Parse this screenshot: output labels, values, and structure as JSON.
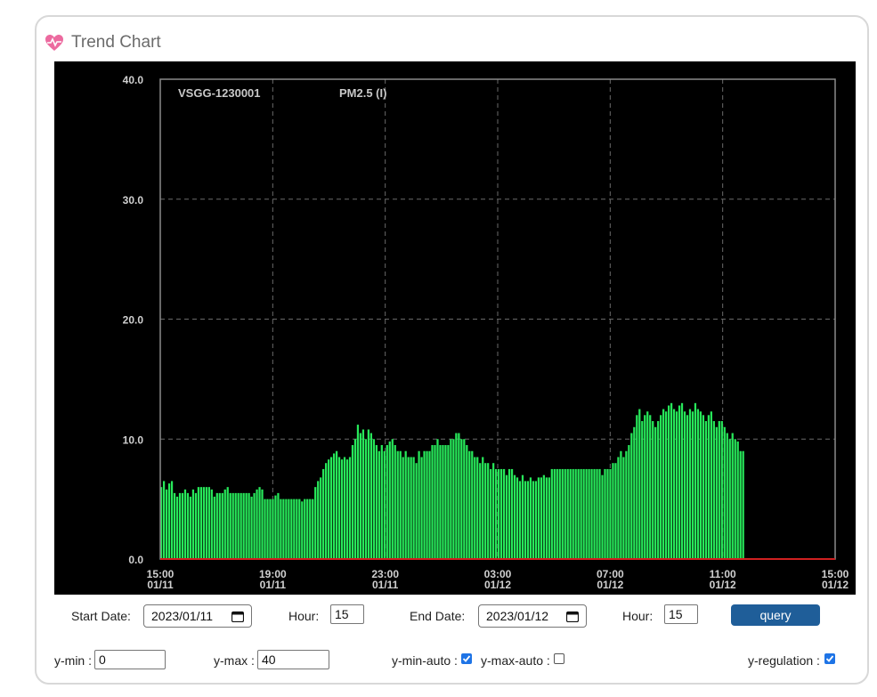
{
  "card": {
    "title": "Trend Chart",
    "icon": "heart-pulse-icon",
    "icon_color": "#e8609a"
  },
  "chart_data": {
    "type": "bar",
    "station": "VSGG-1230001",
    "series_name": "PM2.5 (I)",
    "ylim": [
      0,
      40
    ],
    "yticks": [
      "0.0",
      "10.0",
      "20.0",
      "30.0",
      "40.0"
    ],
    "xticks": [
      {
        "time": "15:00",
        "date": "01/11"
      },
      {
        "time": "19:00",
        "date": "01/11"
      },
      {
        "time": "23:00",
        "date": "01/11"
      },
      {
        "time": "03:00",
        "date": "01/12"
      },
      {
        "time": "07:00",
        "date": "01/12"
      },
      {
        "time": "11:00",
        "date": "01/12"
      },
      {
        "time": "15:00",
        "date": "01/12"
      }
    ],
    "x_range_hours": 24,
    "bar_color": "#27e85a",
    "background": "#000000",
    "grid": "dashed",
    "values": [
      6.0,
      6.5,
      5.8,
      6.3,
      6.5,
      5.5,
      5.2,
      5.5,
      5.5,
      5.8,
      5.5,
      5.2,
      5.8,
      5.5,
      6.0,
      6.0,
      6.0,
      6.0,
      6.0,
      5.8,
      5.2,
      5.5,
      5.5,
      5.5,
      5.8,
      6.0,
      5.5,
      5.5,
      5.5,
      5.5,
      5.5,
      5.5,
      5.5,
      5.5,
      5.2,
      5.5,
      5.8,
      6.0,
      5.8,
      5.0,
      5.0,
      5.0,
      5.0,
      5.3,
      5.5,
      5.0,
      5.0,
      5.0,
      5.0,
      5.0,
      5.0,
      5.0,
      5.0,
      4.8,
      5.0,
      5.0,
      5.0,
      5.0,
      6.0,
      6.5,
      6.8,
      7.5,
      8.0,
      8.3,
      8.5,
      8.8,
      9.0,
      8.5,
      8.3,
      8.5,
      8.3,
      8.5,
      9.5,
      10.0,
      11.2,
      10.5,
      10.8,
      10.0,
      10.8,
      10.5,
      10.0,
      9.5,
      9.0,
      9.5,
      9.0,
      9.5,
      9.8,
      10.0,
      9.5,
      9.0,
      9.0,
      8.5,
      9.0,
      8.5,
      8.5,
      8.5,
      8.0,
      9.0,
      8.5,
      9.0,
      9.0,
      9.0,
      9.5,
      9.5,
      10.0,
      9.5,
      9.5,
      9.5,
      9.5,
      10.0,
      10.0,
      10.5,
      10.5,
      10.0,
      10.0,
      9.5,
      9.0,
      9.0,
      8.5,
      8.5,
      8.0,
      8.5,
      8.0,
      8.0,
      7.5,
      8.0,
      7.5,
      7.5,
      7.5,
      7.5,
      7.0,
      7.5,
      7.5,
      7.0,
      6.8,
      6.5,
      7.0,
      6.5,
      6.5,
      6.8,
      6.5,
      6.5,
      6.8,
      6.8,
      7.0,
      6.8,
      6.8,
      7.5,
      7.5,
      7.5,
      7.5,
      7.5,
      7.5,
      7.5,
      7.5,
      7.5,
      7.5,
      7.5,
      7.5,
      7.5,
      7.5,
      7.5,
      7.5,
      7.5,
      7.5,
      7.5,
      7.0,
      7.5,
      7.5,
      7.5,
      8.0,
      8.0,
      8.5,
      9.0,
      8.5,
      9.0,
      9.5,
      10.5,
      11.0,
      12.0,
      12.5,
      11.5,
      12.0,
      12.3,
      12.0,
      11.5,
      11.0,
      11.5,
      12.0,
      12.5,
      12.3,
      12.8,
      13.0,
      12.5,
      12.3,
      12.8,
      13.0,
      12.3,
      12.0,
      12.5,
      12.3,
      13.0,
      12.5,
      12.3,
      12.0,
      11.5,
      12.0,
      12.3,
      11.5,
      11.0,
      11.5,
      11.5,
      11.0,
      10.5,
      10.0,
      10.5,
      10.0,
      9.8,
      9.0,
      9.0
    ]
  },
  "controls": {
    "start_date_label": "Start Date:",
    "start_date_value": "2023/01/11",
    "start_hour_label": "Hour:",
    "start_hour_value": "15",
    "end_date_label": "End Date:",
    "end_date_value": "2023/01/12",
    "end_hour_label": "Hour:",
    "end_hour_value": "15",
    "query_label": "query",
    "ymin_label": "y-min :",
    "ymin_value": "0",
    "ymax_label": "y-max :",
    "ymax_value": "40",
    "ymin_auto_label": "y-min-auto :",
    "ymin_auto_checked": true,
    "ymax_auto_label": "y-max-auto :",
    "ymax_auto_checked": false,
    "yreg_label": "y-regulation :",
    "yreg_checked": true
  }
}
